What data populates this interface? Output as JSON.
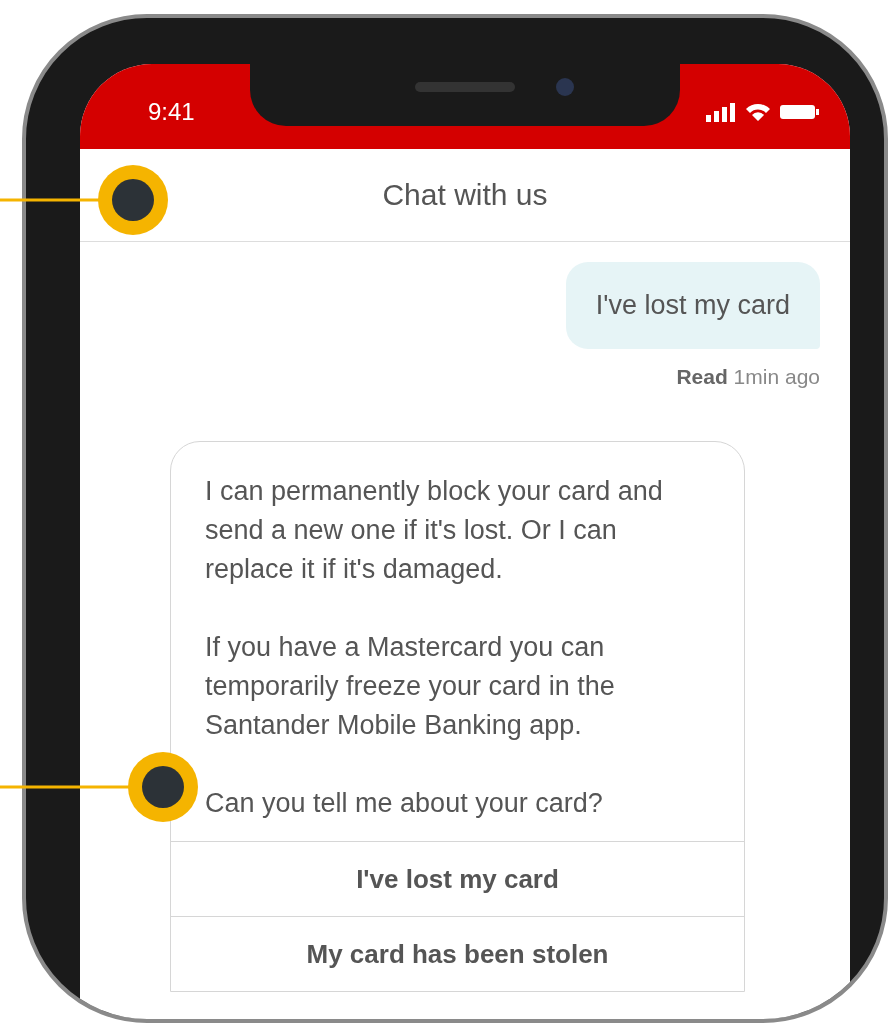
{
  "status_bar": {
    "time": "9:41"
  },
  "header": {
    "title": "Chat with us"
  },
  "messages": [
    {
      "kind": "user",
      "text": "I've lost my card",
      "status": "**Read** 1min ago"
    },
    {
      "kind": "bot",
      "paragraphs": [
        "I can permanently block your card and send a new one if it's lost. Or I can replace it if it's damaged.",
        "If you have a Mastercard you can temporarily freeze your card in the Santander Mobile Banking app.",
        "Can you tell me about your card?"
      ],
      "options": [
        "I've lost my card",
        "My card has been stolen"
      ]
    }
  ]
}
